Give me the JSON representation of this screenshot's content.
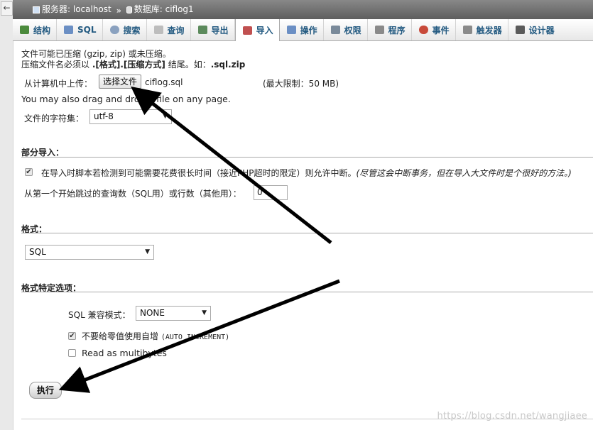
{
  "breadcrumb": {
    "server_label": "服务器: localhost",
    "separator": "»",
    "database_label": "数据库: ciflog1"
  },
  "tabs": [
    {
      "label": "结构",
      "icon": "structure-icon",
      "color": "#4b8a3c"
    },
    {
      "label": "SQL",
      "icon": "sql-icon",
      "color": "#6b8fc4"
    },
    {
      "label": "搜索",
      "icon": "search-icon",
      "color": "#8aa1bf"
    },
    {
      "label": "查询",
      "icon": "query-icon",
      "color": "#bdbdbd"
    },
    {
      "label": "导出",
      "icon": "export-icon",
      "color": "#5c8a5c"
    },
    {
      "label": "导入",
      "icon": "import-icon",
      "color": "#c05050"
    },
    {
      "label": "操作",
      "icon": "operations-icon",
      "color": "#6b8fc4"
    },
    {
      "label": "权限",
      "icon": "privileges-icon",
      "color": "#7a8a9a"
    },
    {
      "label": "程序",
      "icon": "routines-icon",
      "color": "#8a8a8a"
    },
    {
      "label": "事件",
      "icon": "events-icon",
      "color": "#c84a3a"
    },
    {
      "label": "触发器",
      "icon": "triggers-icon",
      "color": "#8a8a8a"
    },
    {
      "label": "设计器",
      "icon": "designer-icon",
      "color": "#5a5a5a"
    }
  ],
  "file": {
    "note_line1": "文件可能已压缩 (gzip, zip) 或未压缩。",
    "note_line2_pre": "压缩文件名必须以 ",
    "note_line2_fmt": ".[格式].[压缩方式]",
    "note_line2_mid": " 结尾。如：",
    "note_line2_example": ".sql.zip",
    "upload_label": "从计算机中上传：",
    "choose_button": "选择文件",
    "chosen_file": "ciflog.sql",
    "max_limit": "(最大限制：50 MB)",
    "drag_hint": "You may also drag and drop a file on any page.",
    "charset_label": "文件的字符集：",
    "charset_value": "utf-8"
  },
  "partial": {
    "title": "部分导入：",
    "allow_interrupt_label": "在导入时脚本若检测到可能需要花费很长时间（接近PHP超时的限定）则允许中断。",
    "allow_interrupt_note": "(尽管这会中断事务，但在导入大文件时是个很好的方法。)",
    "allow_interrupt_checked": true,
    "skip_label": "从第一个开始跳过的查询数（SQL用）或行数（其他用）：",
    "skip_value": "0"
  },
  "format": {
    "title": "格式：",
    "selected": "SQL"
  },
  "format_options": {
    "title": "格式特定选项：",
    "compat_label": "SQL 兼容模式：",
    "compat_value": "NONE",
    "no_auto_value_label": "不要给零值使用自增",
    "no_auto_value_code": "(AUTO_INCREMENT)",
    "no_auto_value_checked": true,
    "multibytes_label": "Read as multibytes",
    "multibytes_checked": false
  },
  "go_button": "执行",
  "watermark": "https://blog.csdn.net/wangjiaee",
  "colors": {
    "tab_text": "#235a81",
    "annotation_arrow": "#000000"
  }
}
